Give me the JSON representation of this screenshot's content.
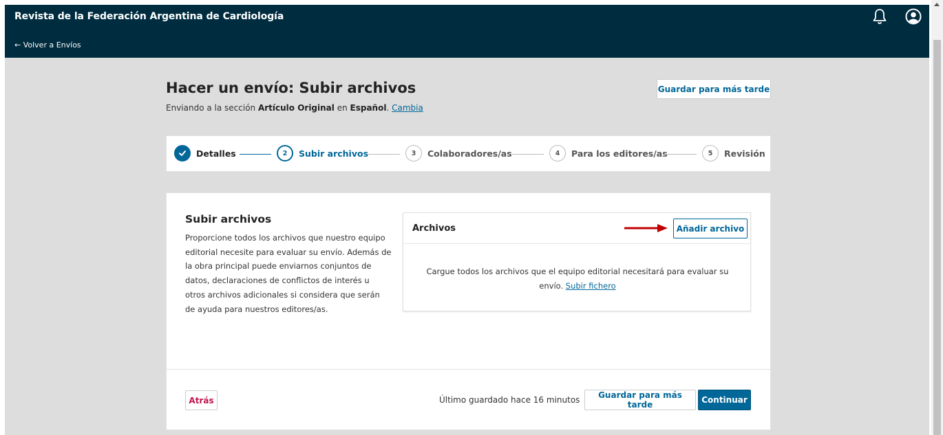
{
  "header": {
    "site_title": "Revista de la Federación Argentina de Cardiología",
    "back_link": "← Volver a Envíos",
    "icons": [
      "bell-icon",
      "user-circle-icon"
    ]
  },
  "page": {
    "title": "Hacer un envío: Subir archivos",
    "sub_prefix": "Enviando a la sección ",
    "sub_section": "Artículo Original",
    "sub_mid": " en ",
    "sub_lang": "Español",
    "sub_dot": ". ",
    "sub_change": "Cambia",
    "save_later": "Guardar para más tarde"
  },
  "steps": [
    {
      "number": "",
      "label": "Detalles",
      "state": "done"
    },
    {
      "number": "2",
      "label": "Subir archivos",
      "state": "current"
    },
    {
      "number": "3",
      "label": "Colaboradores/as",
      "state": "pending"
    },
    {
      "number": "4",
      "label": "Para los editores/as",
      "state": "pending"
    },
    {
      "number": "5",
      "label": "Revisión",
      "state": "pending"
    }
  ],
  "upload": {
    "section_title": "Subir archivos",
    "description": "Proporcione todos los archivos que nuestro equipo editorial necesite para evaluar su envío. Además de la obra principal puede enviarnos conjuntos de datos, declaraciones de conflictos de interés u otros archivos adicionales si considera que serán de ayuda para nuestros editores/as.",
    "files_title": "Archivos",
    "add_file": "Añadir archivo",
    "empty_text": "Cargue todos los archivos que el equipo editorial necesitará para evaluar su envío. ",
    "upload_link": "Subir fichero"
  },
  "footer": {
    "back": "Atrás",
    "last_saved": "Último guardado hace 16 minutos",
    "save_later": "Guardar para más tarde",
    "continue": "Continuar"
  },
  "colors": {
    "header_bg": "#002c3f",
    "accent": "#006798",
    "back_button": "#c0144f",
    "annotation_arrow": "#c00000"
  }
}
